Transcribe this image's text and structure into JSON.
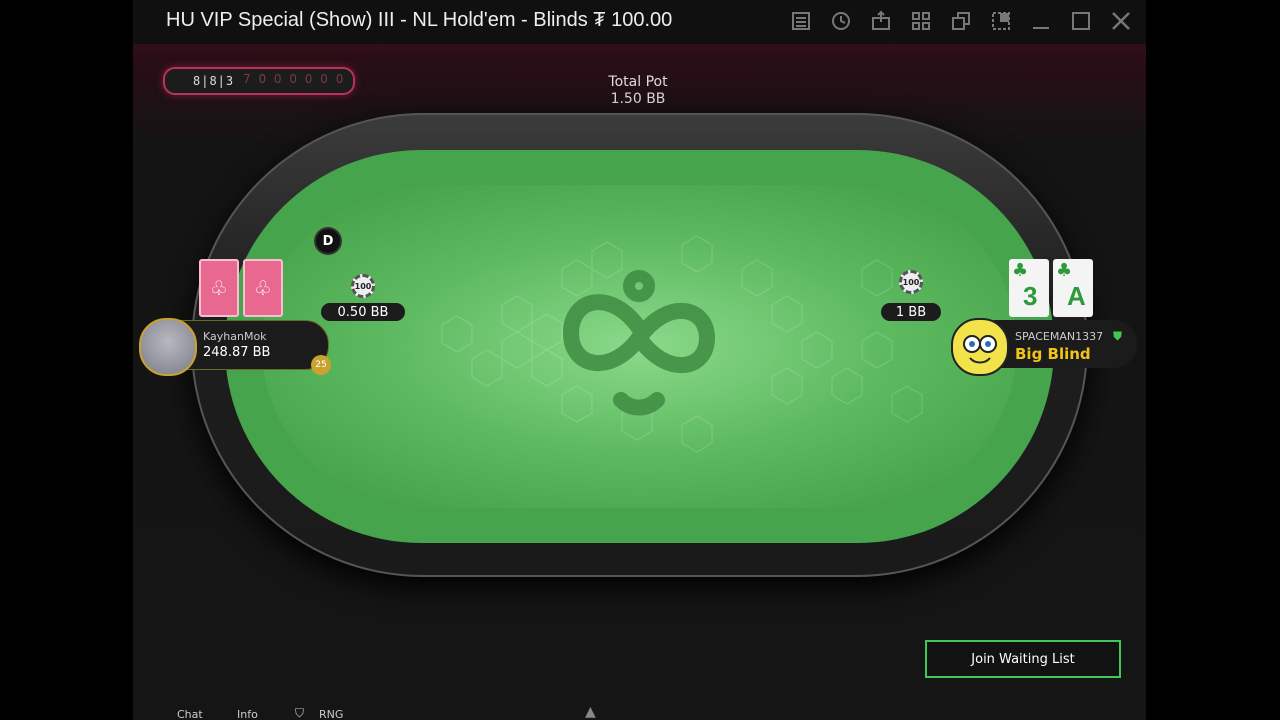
{
  "window": {
    "title": "HU VIP Special (Show) III - NL Hold'em - Blinds ₮ 100.00",
    "icons": [
      "list-icon",
      "history-icon",
      "export-icon",
      "grid-icon",
      "tables-icon",
      "resize-icon",
      "minimize-icon",
      "maximize-icon",
      "close-icon"
    ]
  },
  "hand_history": {
    "cards": "8|8|3",
    "rest": "7 0 0 0 0 0 0"
  },
  "pot": {
    "label": "Total Pot",
    "value": "1.50 BB"
  },
  "dealer_button": "D",
  "players": [
    {
      "name": "KayhanMok",
      "stack": "248.87 BB",
      "bet": "0.50 BB",
      "chip_label": "100",
      "timer": "25",
      "cards": [
        "back",
        "back"
      ]
    },
    {
      "name": "SPACEMAN1337",
      "status": "Big Blind",
      "bet": "1 BB",
      "chip_label": "100",
      "cards": [
        {
          "rank": "3",
          "suit": "♣"
        },
        {
          "rank": "A",
          "suit": "♣"
        }
      ]
    }
  ],
  "join_button": "Join Waiting List",
  "bottom_bar": {
    "chat": "Chat",
    "info": "Info",
    "rng": "RNG"
  },
  "colors": {
    "felt": "#5fbb62",
    "accent": "#3ec956",
    "card_back": "#e8688f",
    "highlight": "#b4345a"
  }
}
